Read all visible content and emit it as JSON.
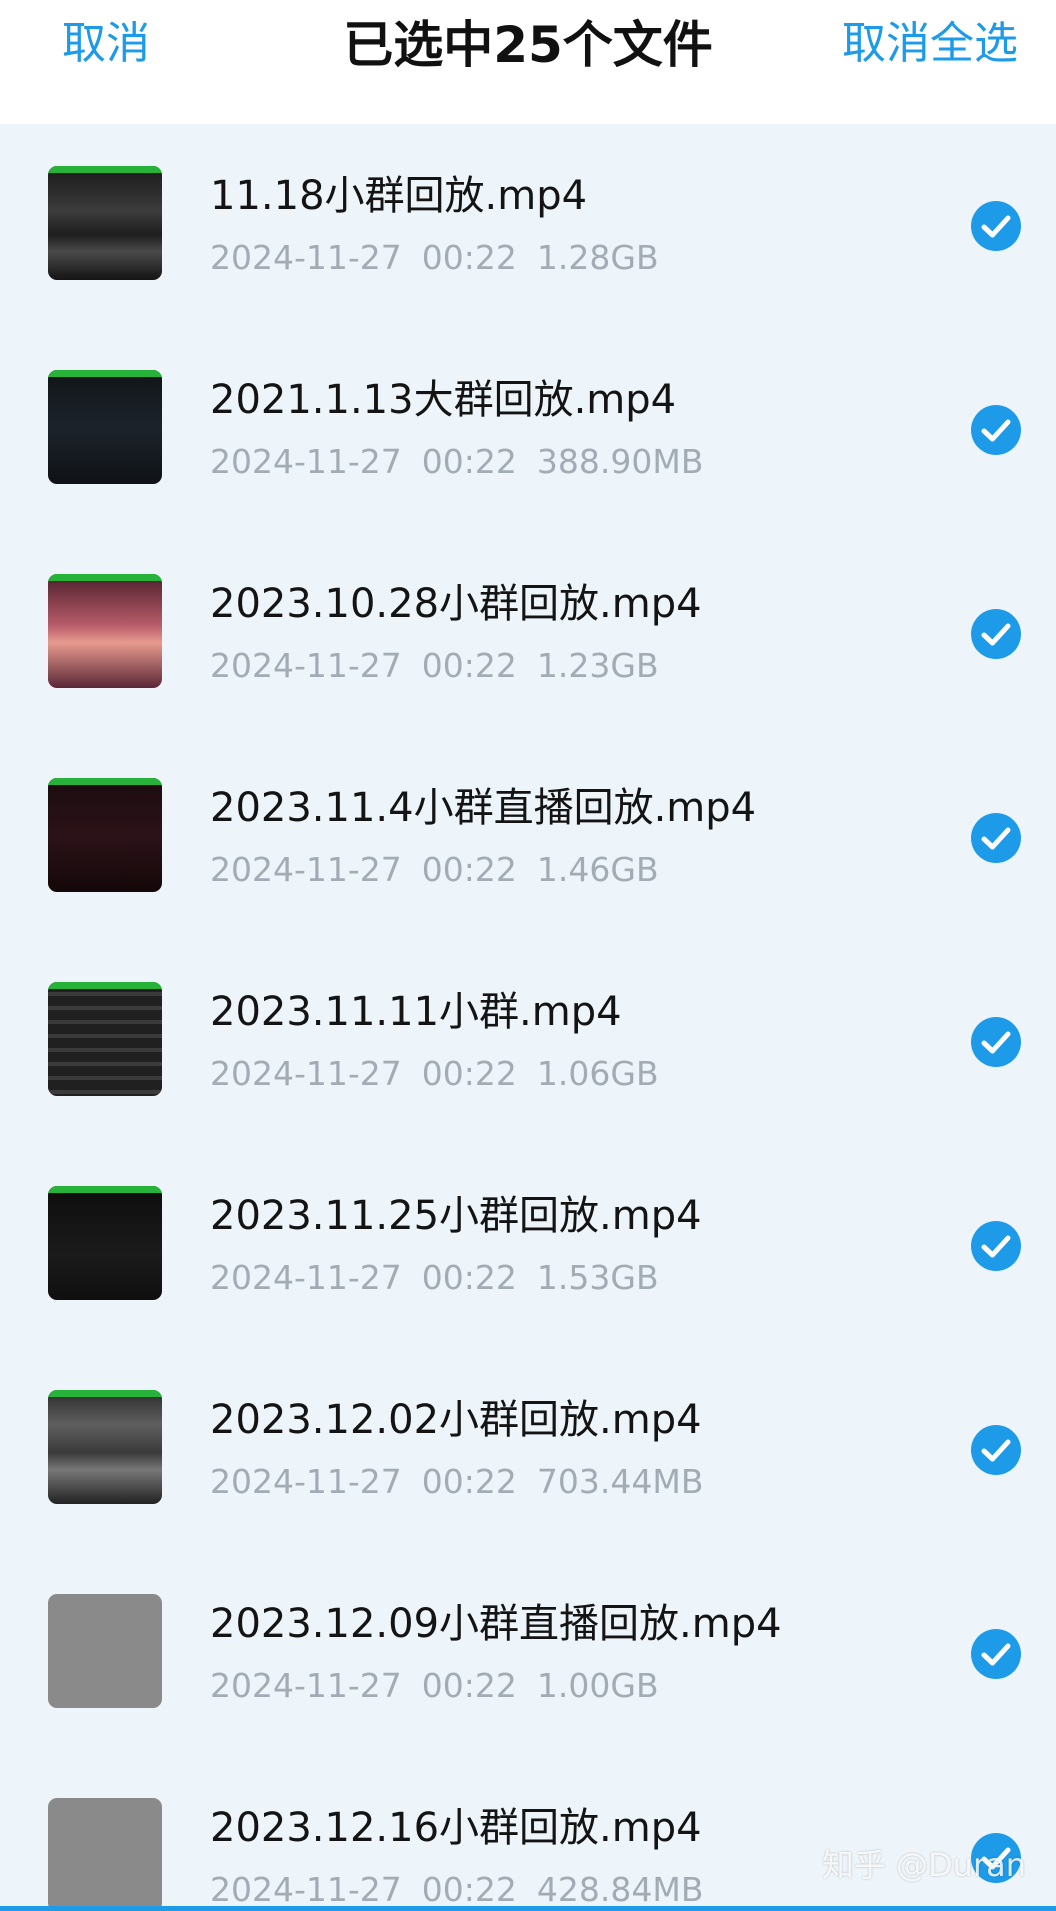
{
  "header": {
    "cancel_label": "取消",
    "title": "已选中25个文件",
    "deselect_all_label": "取消全选"
  },
  "files": [
    {
      "name": "11.18小群回放.mp4",
      "date": "2024-11-27",
      "time": "00:22",
      "size": "1.28GB",
      "thumbnail": "t-dark-grey",
      "selected": true
    },
    {
      "name": "2021.1.13大群回放.mp4",
      "date": "2024-11-27",
      "time": "00:22",
      "size": "388.90MB",
      "thumbnail": "t-dark-blue",
      "selected": true
    },
    {
      "name": "2023.10.28小群回放.mp4",
      "date": "2024-11-27",
      "time": "00:22",
      "size": "1.23GB",
      "thumbnail": "t-sunset",
      "selected": true
    },
    {
      "name": "2023.11.4小群直播回放.mp4",
      "date": "2024-11-27",
      "time": "00:22",
      "size": "1.46GB",
      "thumbnail": "t-maroon",
      "selected": true
    },
    {
      "name": "2023.11.11小群.mp4",
      "date": "2024-11-27",
      "time": "00:22",
      "size": "1.06GB",
      "thumbnail": "t-stripes",
      "selected": true
    },
    {
      "name": "2023.11.25小群回放.mp4",
      "date": "2024-11-27",
      "time": "00:22",
      "size": "1.53GB",
      "thumbnail": "t-terminal",
      "selected": true
    },
    {
      "name": "2023.12.02小群回放.mp4",
      "date": "2024-11-27",
      "time": "00:22",
      "size": "703.44MB",
      "thumbnail": "t-glitch",
      "selected": true
    },
    {
      "name": "2023.12.09小群直播回放.mp4",
      "date": "2024-11-27",
      "time": "00:22",
      "size": "1.00GB",
      "thumbnail": "t-grey",
      "selected": true
    },
    {
      "name": "2023.12.16小群回放.mp4",
      "date": "2024-11-27",
      "time": "00:22",
      "size": "428.84MB",
      "thumbnail": "t-grey",
      "selected": true
    }
  ],
  "watermark": "知乎 @Duran",
  "colors": {
    "accent": "#1e9be8",
    "background": "#eef5fa",
    "meta_text": "#a3acb5",
    "thumbnail_bar": "#27b23a"
  }
}
